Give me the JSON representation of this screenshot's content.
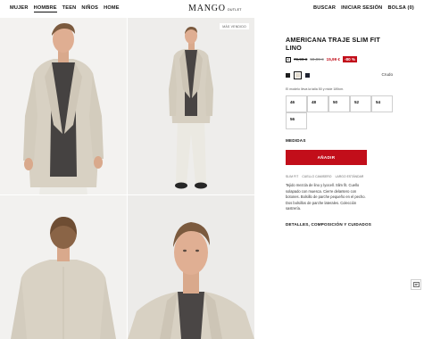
{
  "nav": {
    "items": [
      {
        "label": "MUJER"
      },
      {
        "label": "HOMBRE",
        "active": true
      },
      {
        "label": "TEEN"
      },
      {
        "label": "NIÑOS"
      },
      {
        "label": "HOME"
      }
    ]
  },
  "logo": {
    "brand": "MANGO",
    "sub": "OUTLET"
  },
  "actions": {
    "search": "BUSCAR",
    "login": "INICIAR SESIÓN",
    "bag": "BOLSA (0)"
  },
  "gallery": {
    "tag": "MÁS VENDIDO"
  },
  "product": {
    "title": "AMERICANA TRAJE SLIM FIT LINO",
    "prices": {
      "old1": "79,99 €",
      "old2": "59,99 €",
      "current": "15,99 €",
      "discount": "-80 %"
    },
    "swatches": [
      {
        "color": "#1c1c1c",
        "icon": "swatch-dark"
      },
      {
        "color": "#e4ddd0",
        "icon": "swatch-cream",
        "selected": true
      },
      {
        "color": "#1e2230",
        "icon": "swatch-navy"
      }
    ],
    "color_name": "Crudo",
    "model_note": "El modelo lleva la talla 50 y mide 189cm.",
    "sizes": [
      "46",
      "48",
      "50",
      "52",
      "54",
      "56"
    ],
    "size_guide": "MEDIDAS",
    "add_button": "AÑADIR",
    "breadcrumbs": [
      "SLIM FIT",
      "CUELLO CAMISERO",
      "LARGO ESTÁNDAR"
    ],
    "description": "Tejido mezcla de lino y lyocell. Slim fit. Cuello solapado con muesca. Cierre delantero con botones. Bolsillo de parche pequeño en el pecho. Dos bolsillos de parche laterales. Colección sastrería.",
    "details": "DETALLES, COMPOSICIÓN Y CUIDADOS"
  },
  "colors": {
    "accent": "#c20e1a",
    "text": "#111111"
  }
}
